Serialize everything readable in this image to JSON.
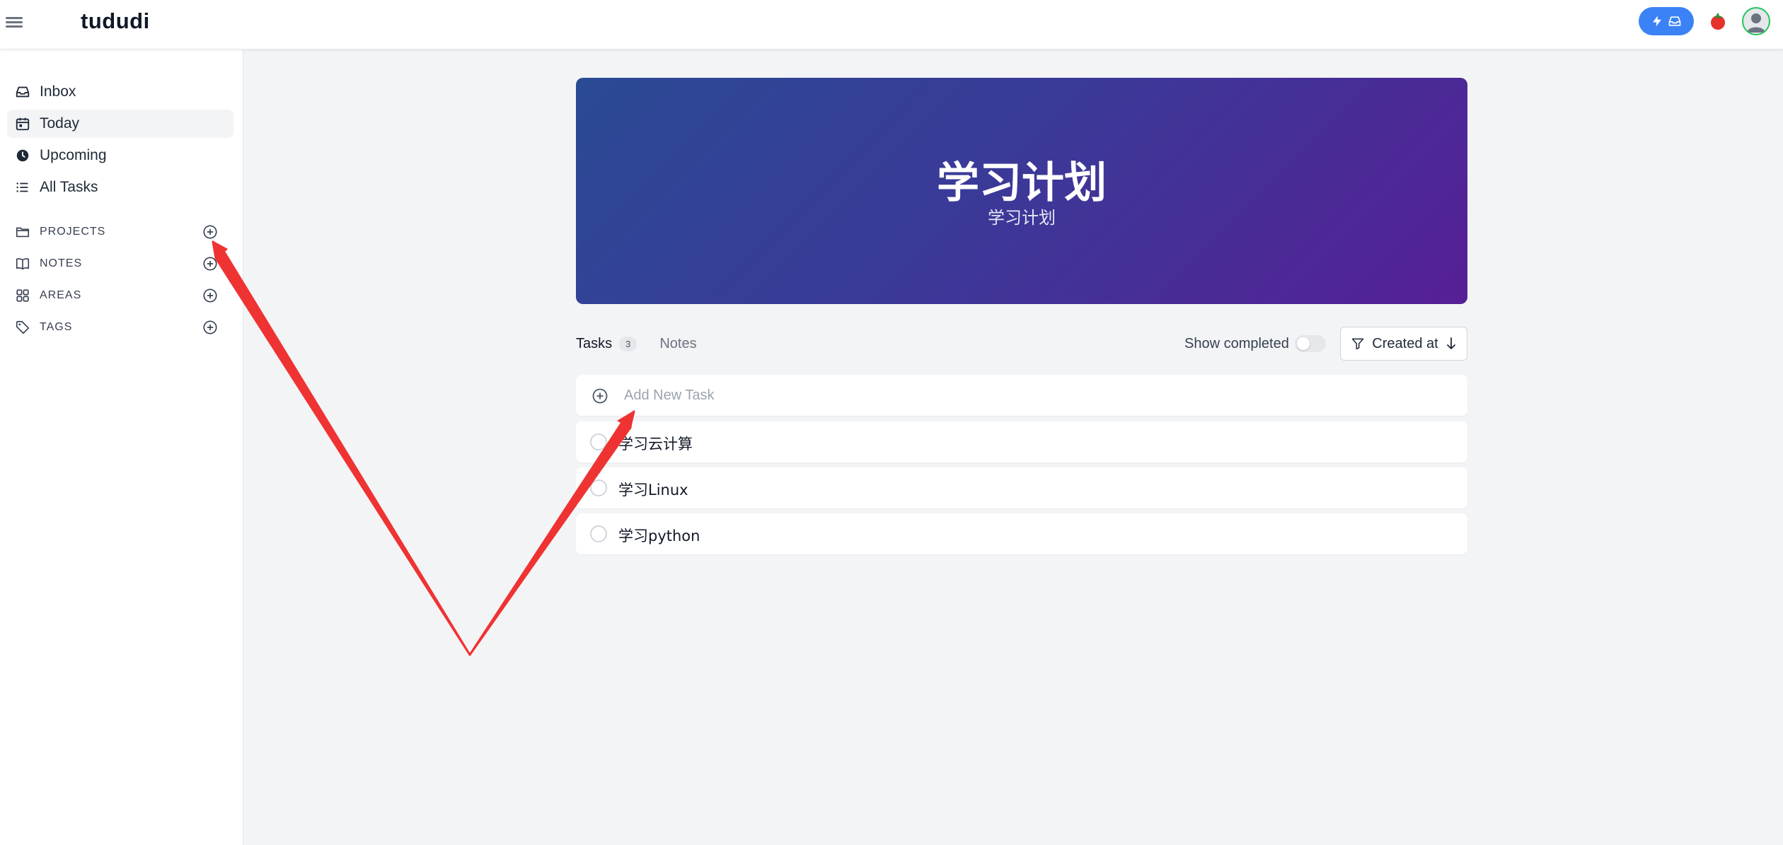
{
  "app": {
    "brand": "tududi"
  },
  "topbar": {
    "quick_capture_icons": [
      "bolt-icon",
      "inbox-icon"
    ],
    "tomato_icon": "tomato-icon",
    "avatar_icon": "user-avatar-icon",
    "accent": "#3b82f6"
  },
  "sidebar": {
    "nav": [
      {
        "label": "Inbox",
        "icon": "inbox-icon"
      },
      {
        "label": "Today",
        "icon": "calendar-icon"
      },
      {
        "label": "Upcoming",
        "icon": "clock-icon"
      },
      {
        "label": "All Tasks",
        "icon": "list-icon"
      }
    ],
    "sections": [
      {
        "label": "PROJECTS",
        "icon": "folder-icon"
      },
      {
        "label": "NOTES",
        "icon": "book-icon"
      },
      {
        "label": "AREAS",
        "icon": "grid-icon"
      },
      {
        "label": "TAGS",
        "icon": "tag-icon"
      }
    ]
  },
  "project": {
    "title": "学习计划",
    "subtitle": "学习计划",
    "banner_colors": [
      "#2a4a94",
      "#561f95"
    ]
  },
  "tabs": [
    {
      "label": "Tasks",
      "count": "3"
    },
    {
      "label": "Notes"
    }
  ],
  "controls": {
    "show_completed_label": "Show completed",
    "show_completed_on": false,
    "sort_label": "Created at",
    "sort_direction_icon": "arrow-down-icon"
  },
  "add_task": {
    "placeholder": "Add New Task"
  },
  "tasks": [
    {
      "name": "学习云计算"
    },
    {
      "name": "学习Linux"
    },
    {
      "name": "学习python"
    }
  ],
  "annotation": {
    "color": "#ef3333"
  }
}
